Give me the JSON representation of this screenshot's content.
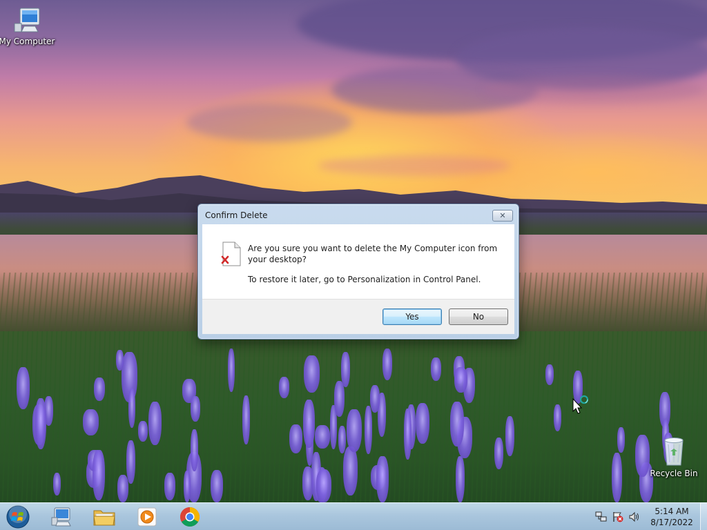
{
  "desktop": {
    "icons": [
      {
        "label": "My Computer",
        "icon": "computer-icon"
      },
      {
        "label": "Recycle Bin",
        "icon": "recycle-bin-icon"
      }
    ]
  },
  "dialog": {
    "title": "Confirm Delete",
    "close_icon": "close-icon",
    "file_icon": "delete-file-icon",
    "message": "Are you sure you want to delete the My Computer icon from your desktop?",
    "note": "To restore it later, go to Personalization in Control Panel.",
    "yes_label": "Yes",
    "no_label": "No"
  },
  "taskbar": {
    "start_icon": "windows-start-icon",
    "pinned": [
      {
        "icon": "computer-explorer-icon"
      },
      {
        "icon": "folder-icon"
      },
      {
        "icon": "media-player-icon"
      },
      {
        "icon": "chrome-icon"
      }
    ],
    "tray_icons": [
      "network-icon",
      "action-center-flag-icon",
      "volume-icon"
    ],
    "time": "5:14 AM",
    "date": "8/17/2022"
  },
  "colors": {
    "taskbar": "#afcde4",
    "dialog_frame": "#c9dbee",
    "default_button": "#bee6fd"
  }
}
